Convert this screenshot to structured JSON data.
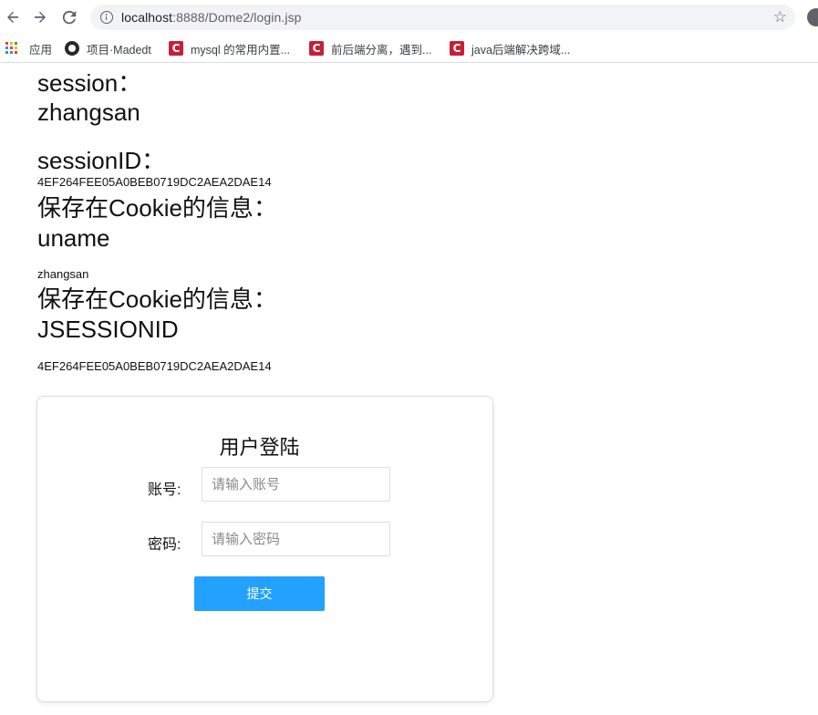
{
  "browser": {
    "url_host": "localhost",
    "url_rest": ":8888/Dome2/login.jsp",
    "bookmarks": [
      {
        "label": "应用",
        "icon": "apps-grid-icon"
      },
      {
        "label": "项目·Madedt",
        "icon": "github-icon"
      },
      {
        "label": "mysql 的常用内置...",
        "icon": "csdn-icon"
      },
      {
        "label": "前后端分离，遇到...",
        "icon": "csdn-icon"
      },
      {
        "label": "java后端解决跨域...",
        "icon": "csdn-icon"
      }
    ],
    "colors": {
      "omnibox_bg": "#f1f3f4",
      "csdn_red": "#c32136"
    }
  },
  "page": {
    "session_label": "session：",
    "session_value": "zhangsan",
    "session_id_label": "sessionID：",
    "session_id_value": "4EF264FEE05A0BEB0719DC2AEA2DAE14",
    "cookie1_label": "保存在Cookie的信息：",
    "cookie1_name": "uname",
    "cookie1_value": "zhangsan",
    "cookie2_label": "保存在Cookie的信息：",
    "cookie2_name": "JSESSIONID",
    "cookie2_value": "4EF264FEE05A0BEB0719DC2AEA2DAE14"
  },
  "login": {
    "title": "用户登陆",
    "account_label": "账号:",
    "account_placeholder": "请输入账号",
    "account_value": "",
    "password_label": "密码:",
    "password_placeholder": "请输入密码",
    "password_value": "",
    "submit_label": "提交",
    "colors": {
      "button_bg": "#22a1ff",
      "button_text": "#ffffff"
    }
  }
}
